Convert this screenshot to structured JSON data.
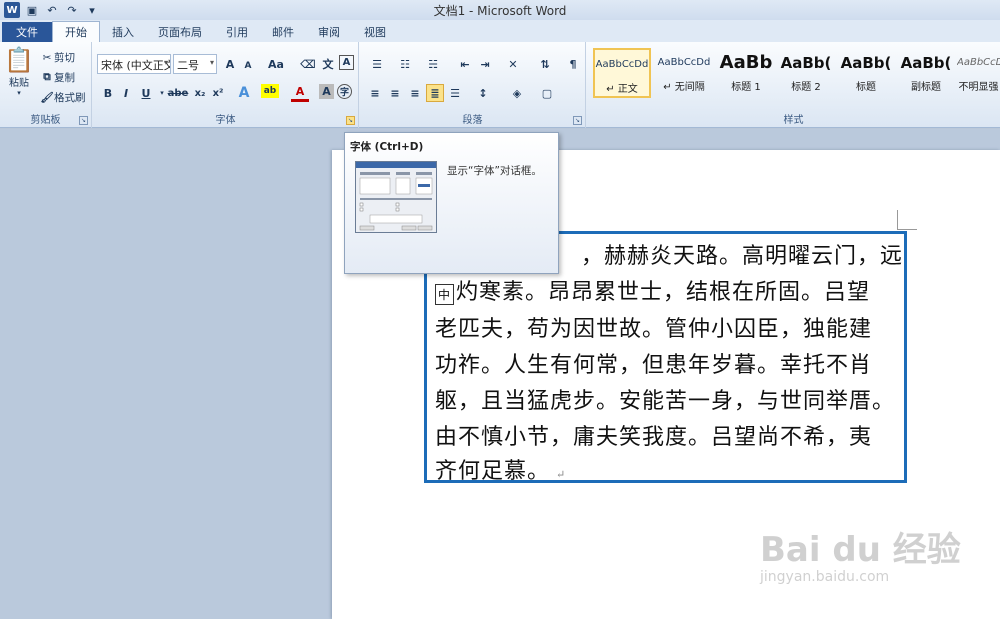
{
  "window": {
    "title": "文档1 - Microsoft Word"
  },
  "tabs": [
    {
      "label": "文件"
    },
    {
      "label": "开始"
    },
    {
      "label": "插入"
    },
    {
      "label": "页面布局"
    },
    {
      "label": "引用"
    },
    {
      "label": "邮件"
    },
    {
      "label": "审阅"
    },
    {
      "label": "视图"
    }
  ],
  "clipboard": {
    "paste": "粘贴",
    "cut": "剪切",
    "copy": "复制",
    "format_painter": "格式刷",
    "group_label": "剪贴板"
  },
  "font": {
    "face": "宋体 (中文正文",
    "size": "二号",
    "group_label": "字体",
    "bold": "B",
    "italic": "I",
    "underline": "U",
    "strike": "abe",
    "subscript": "x₂",
    "superscript": "x²",
    "grow": "A",
    "shrink": "A",
    "case": "Aa",
    "clear": "A"
  },
  "paragraph": {
    "group_label": "段落"
  },
  "styles": {
    "group_label": "样式",
    "items": [
      {
        "sample": "AaBbCcDd",
        "name": "↵ 正文"
      },
      {
        "sample": "AaBbCcDd",
        "name": "↵ 无间隔"
      },
      {
        "sample": "AaBb",
        "name": "标题 1"
      },
      {
        "sample": "AaBb(",
        "name": "标题 2"
      },
      {
        "sample": "AaBb(",
        "name": "标题"
      },
      {
        "sample": "AaBb(",
        "name": "副标题"
      },
      {
        "sample": "AaBbCcD",
        "name": "不明显强"
      }
    ]
  },
  "tooltip": {
    "title": "字体 (Ctrl+D)",
    "description": "显示“字体”对话框。"
  },
  "document": {
    "ime_indicator": "中",
    "lines": [
      "，赫赫炎天路。高明曜云门，远",
      "灼寒素。昂昂累世士，结根在所固。吕望",
      "老匹夫，苟为因世故。管仲小囚臣，独能建",
      "功祚。人生有何常，但患年岁暮。幸托不肖",
      "躯，且当猛虎步。安能苦一身，与世同举厝。",
      "由不慎小节，庸夫笑我度。吕望尚不希，夷",
      "齐何足慕。"
    ],
    "paragraph_mark": "↵"
  },
  "watermark": {
    "logo": "Bai du 经验",
    "url": "jingyan.baidu.com"
  },
  "colors": {
    "accent": "#2a5699",
    "textbox_border": "#1c6cb8",
    "highlight": "#fbe28a"
  }
}
